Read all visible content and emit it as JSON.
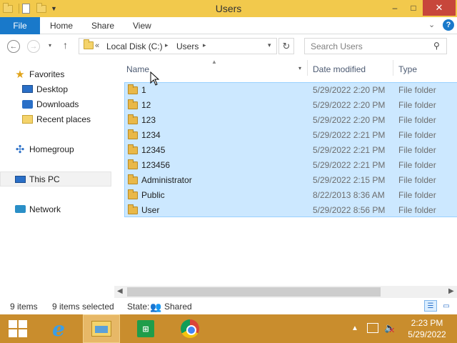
{
  "window": {
    "title": "Users"
  },
  "titlebar_buttons": {
    "minimize": "–",
    "maximize": "□",
    "close": "✕"
  },
  "ribbon": {
    "file": "File",
    "tabs": [
      "Home",
      "Share",
      "View"
    ],
    "help": "?"
  },
  "navbar": {
    "back": "←",
    "forward": "→",
    "recent_dropdown": "▾",
    "up": "↑",
    "address_overflow": "«",
    "address": [
      "Local Disk (C:)",
      "Users"
    ],
    "separator": "▸",
    "address_dropdown": "▾",
    "refresh": "↻",
    "search_placeholder": "Search Users",
    "search_glyph": "⚲"
  },
  "nav_pane": {
    "items": [
      {
        "label": "Favorites",
        "icon": "star-icon"
      },
      {
        "label": "Desktop",
        "icon": "desktop-icon"
      },
      {
        "label": "Downloads",
        "icon": "downloads-icon"
      },
      {
        "label": "Recent places",
        "icon": "recent-places-icon"
      },
      {
        "label": "Homegroup",
        "icon": "homegroup-icon"
      },
      {
        "label": "This PC",
        "icon": "computer-icon",
        "selected": true
      },
      {
        "label": "Network",
        "icon": "network-icon"
      }
    ]
  },
  "columns": {
    "name": "Name",
    "date": "Date modified",
    "type": "Type"
  },
  "files": [
    {
      "name": "1",
      "date": "5/29/2022 2:20 PM",
      "type": "File folder"
    },
    {
      "name": "12",
      "date": "5/29/2022 2:20 PM",
      "type": "File folder"
    },
    {
      "name": "123",
      "date": "5/29/2022 2:20 PM",
      "type": "File folder"
    },
    {
      "name": "1234",
      "date": "5/29/2022 2:21 PM",
      "type": "File folder"
    },
    {
      "name": "12345",
      "date": "5/29/2022 2:21 PM",
      "type": "File folder"
    },
    {
      "name": "123456",
      "date": "5/29/2022 2:21 PM",
      "type": "File folder"
    },
    {
      "name": "Administrator",
      "date": "5/29/2022 2:15 PM",
      "type": "File folder"
    },
    {
      "name": "Public",
      "date": "8/22/2013 8:36 AM",
      "type": "File folder"
    },
    {
      "name": "User",
      "date": "5/29/2022 8:56 PM",
      "type": "File folder"
    }
  ],
  "status": {
    "item_count": "9 items",
    "selected_count": "9 items selected",
    "state_label": "State:",
    "state_value": "Shared"
  },
  "taskbar": {
    "time": "2:23 PM",
    "date": "5/29/2022",
    "apps": [
      "start",
      "internet-explorer",
      "file-explorer",
      "store",
      "chrome"
    ]
  },
  "colors": {
    "title_bar": "#f2c94c",
    "file_tab": "#1979ca",
    "selection": "#cce8ff",
    "taskbar": "#c98d2d",
    "close_button": "#c7463b"
  }
}
